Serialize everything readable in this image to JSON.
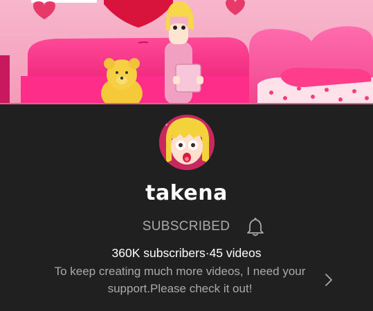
{
  "channel": {
    "name": "takena",
    "subscribe_label": "SUBSCRIBED",
    "subscribers": "360K subscribers",
    "separator": "·",
    "videos": "45 videos",
    "description": "To keep creating much more videos, I need your support.Please check it out!"
  },
  "icons": {
    "notification": "bell-icon",
    "more": "chevron-right-icon"
  },
  "colors": {
    "background": "#202020",
    "primary_text": "#ffffff",
    "secondary_text": "#aaaaaa",
    "banner_pink": "#f5a0c0",
    "sofa_pink": "#ff2d8a"
  }
}
